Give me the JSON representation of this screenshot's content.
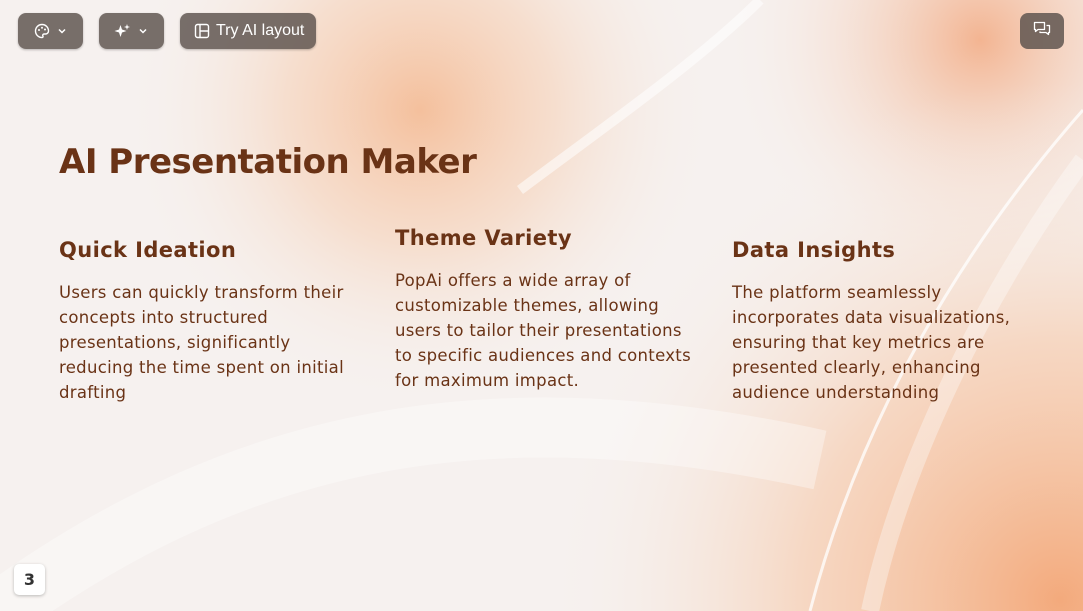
{
  "toolbar": {
    "theme_icon": "palette-icon",
    "ai_icon": "sparkles-icon",
    "layout_icon": "layout-icon",
    "layout_label": "Try AI layout",
    "chat_icon": "chat-icon"
  },
  "slide": {
    "title": "AI Presentation Maker",
    "columns": [
      {
        "heading": "Quick Ideation",
        "body": "Users can quickly transform their concepts into structured presentations, significantly reducing the time spent on initial drafting"
      },
      {
        "heading": "Theme Variety",
        "body": "PopAi offers a wide array of customizable themes, allowing users to tailor their presentations to specific audiences and contexts for maximum impact."
      },
      {
        "heading": "Data Insights",
        "body": "The platform seamlessly incorporates data visualizations, ensuring that key metrics are presented clearly, enhancing audience understanding"
      }
    ],
    "page_number": "3"
  },
  "colors": {
    "text_brown": "#6a3316",
    "accent_peach": "#f2b48a",
    "toolbar_bg": "#5a504c"
  }
}
